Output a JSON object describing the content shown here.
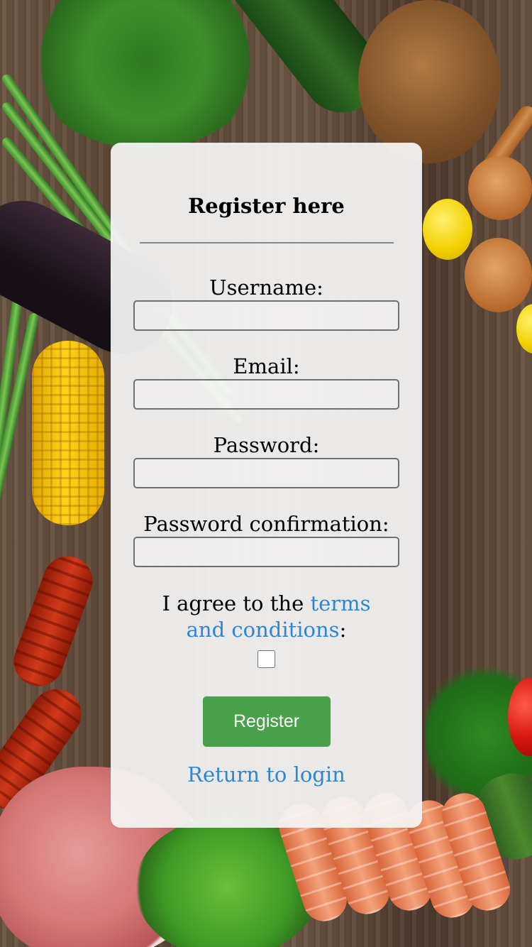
{
  "form": {
    "title": "Register here",
    "fields": [
      {
        "label": "Username:",
        "value": ""
      },
      {
        "label": "Email:",
        "value": ""
      },
      {
        "label": "Password:",
        "value": ""
      },
      {
        "label": "Password confirmation:",
        "value": ""
      }
    ],
    "terms": {
      "prefix": "I agree to the ",
      "link_text": "terms and conditions",
      "suffix": ":",
      "checked": false
    },
    "register_label": "Register",
    "login_link_label": "Return to login"
  },
  "colors": {
    "accent_button": "#4aa14c",
    "link": "#2e86d1"
  }
}
